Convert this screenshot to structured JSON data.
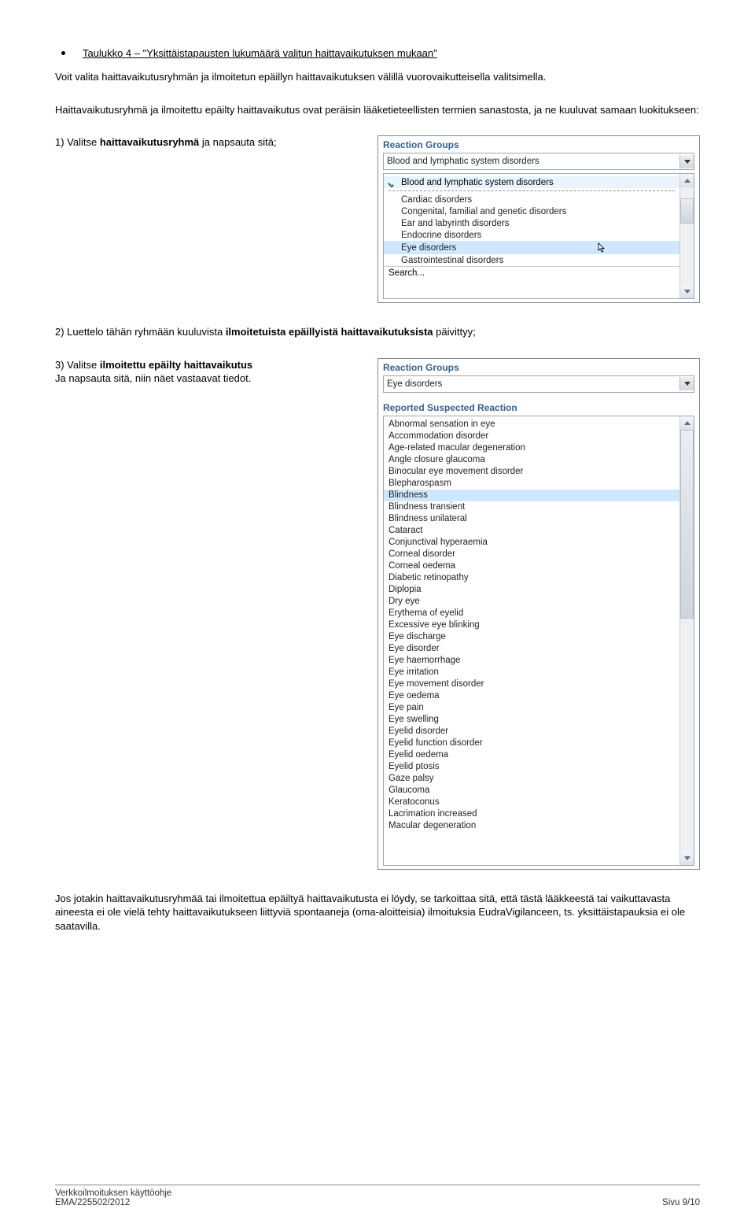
{
  "heading_bullet": "Taulukko 4 – \"Yksittäistapausten lukumäärä valitun haittavaikutuksen mukaan\"",
  "intro_para_1": "Voit valita haittavaikutusryhmän ja ilmoitetun epäillyn haittavaikutuksen välillä vuorovaikutteisella valitsimella.",
  "intro_para_2": "Haittavaikutusryhmä ja ilmoitettu epäilty haittavaikutus ovat peräisin lääketieteellisten termien sanastosta, ja ne kuuluvat samaan luokitukseen:",
  "step1": {
    "prefix": "1) Valitse ",
    "bold": "haittavaikutusryhmä",
    "suffix": " ja napsauta sitä;",
    "ui": {
      "group_label": "Reaction Groups",
      "select_value": "Blood and lymphatic system disorders",
      "checked_first": "Blood and lymphatic system disorders",
      "items": [
        "Cardiac disorders",
        "Congenital, familial and genetic disorders",
        "Ear and labyrinth disorders",
        "Endocrine disorders",
        "Eye disorders",
        "Gastrointestinal disorders"
      ],
      "selected_index": 4,
      "search_label": "Search..."
    }
  },
  "step2": {
    "prefix": "2) Luettelo tähän ryhmään kuuluvista ",
    "bold": "ilmoitetuista epäillyistä haittavaikutuksista",
    "suffix": " päivittyy;"
  },
  "step3": {
    "prefix": "3) Valitse ",
    "bold": "ilmoitettu epäilty haittavaikutus",
    "line2": "Ja napsauta sitä, niin näet vastaavat tiedot.",
    "ui": {
      "group_label": "Reaction Groups",
      "select_value": "Eye disorders",
      "suspected_label": "Reported Suspected Reaction",
      "items": [
        "Abnormal sensation in eye",
        "Accommodation disorder",
        "Age-related macular degeneration",
        "Angle closure glaucoma",
        "Binocular eye movement disorder",
        "Blepharospasm",
        "Blindness",
        "Blindness transient",
        "Blindness unilateral",
        "Cataract",
        "Conjunctival hyperaemia",
        "Corneal disorder",
        "Corneal oedema",
        "Diabetic retinopathy",
        "Diplopia",
        "Dry eye",
        "Erythema of eyelid",
        "Excessive eye blinking",
        "Eye discharge",
        "Eye disorder",
        "Eye haemorrhage",
        "Eye irritation",
        "Eye movement disorder",
        "Eye oedema",
        "Eye pain",
        "Eye swelling",
        "Eyelid disorder",
        "Eyelid function disorder",
        "Eyelid oedema",
        "Eyelid ptosis",
        "Gaze palsy",
        "Glaucoma",
        "Keratoconus",
        "Lacrimation increased",
        "Macular degeneration"
      ],
      "selected_index": 6
    }
  },
  "closing_para": "Jos jotakin haittavaikutusryhmää tai ilmoitettua epäiltyä haittavaikutusta ei löydy, se tarkoittaa sitä, että tästä lääkkeestä tai vaikuttavasta aineesta ei ole vielä tehty haittavaikutukseen liittyviä spontaaneja (oma-aloitteisia) ilmoituksia EudraVigilanceen, ts. yksittäistapauksia ei ole saatavilla.",
  "footer": {
    "left_line1": "Verkkoilmoituksen käyttöohje",
    "left_line2": "EMA/225502/2012",
    "right": "Sivu 9/10"
  }
}
